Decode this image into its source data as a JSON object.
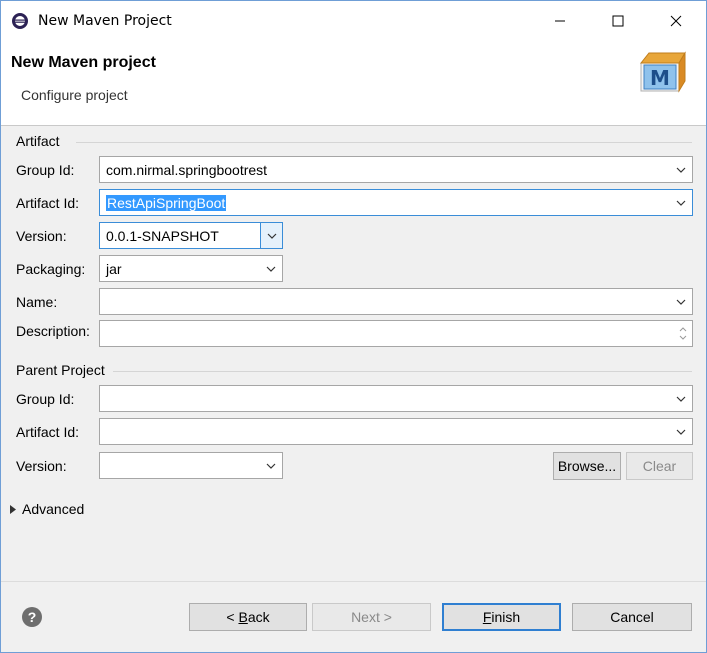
{
  "window": {
    "title": "New Maven Project",
    "controls": {
      "minimize": "minimize",
      "maximize": "maximize",
      "close": "close"
    }
  },
  "banner": {
    "title": "New Maven project",
    "subtitle": "Configure project",
    "logo_letter": "M"
  },
  "artifact": {
    "heading": "Artifact",
    "group_id": {
      "label": "Group Id:",
      "value": "com.nirmal.springbootrest"
    },
    "artifact_id": {
      "label": "Artifact Id:",
      "value": "RestApiSpringBoot"
    },
    "version": {
      "label": "Version:",
      "value": "0.0.1-SNAPSHOT"
    },
    "packaging": {
      "label": "Packaging:",
      "value": "jar"
    },
    "name": {
      "label": "Name:",
      "value": ""
    },
    "description": {
      "label": "Description:",
      "value": ""
    }
  },
  "parent": {
    "heading": "Parent Project",
    "group_id": {
      "label": "Group Id:",
      "value": ""
    },
    "artifact_id": {
      "label": "Artifact Id:",
      "value": ""
    },
    "version": {
      "label": "Version:",
      "value": ""
    },
    "browse_label": "Browse...",
    "clear_label": "Clear"
  },
  "advanced": {
    "label": "Advanced"
  },
  "footer": {
    "help_glyph": "?",
    "back_prefix": "< ",
    "back_mnemonic": "B",
    "back_rest": "ack",
    "next_label": "Next >",
    "finish_mnemonic": "F",
    "finish_rest": "inish",
    "cancel_label": "Cancel"
  },
  "colors": {
    "accent": "#3a8dd8",
    "selection": "#3399ff",
    "window_border": "#6f9ed6"
  }
}
